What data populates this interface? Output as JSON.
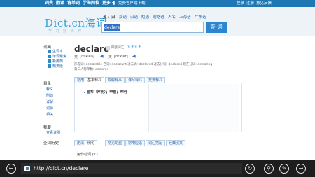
{
  "topnav": {
    "items": [
      "词典",
      "翻译",
      "背单词",
      "学海网校",
      "更多 ▾"
    ],
    "download": "免费客户端下载",
    "login": "登录",
    "register": "注册",
    "help": "意见反馈"
  },
  "header": {
    "logo": "Dict.cn海词",
    "logo_tagline": "学 习 好 伙 伴",
    "dict_tabs": [
      "英 ▸ 汉",
      "双语",
      "汉语",
      "短语",
      "缩略语",
      "人名",
      "上海话",
      "广东话"
    ],
    "search_value": "declare",
    "search_button": "查 词"
  },
  "sidebar": {
    "section1_title": "词典",
    "section1_items": [
      "生词本",
      "单词聚焦",
      "新奥典",
      "精英版"
    ],
    "section2_title": "目录",
    "section2_items": [
      "释义",
      "例句",
      "详解",
      "词源",
      "相关"
    ],
    "section3_title": "我要",
    "section3_items": [
      "查看说明"
    ],
    "section4_title": "查词历史"
  },
  "entry": {
    "word": "declare",
    "level_label": "四级词汇",
    "stars": "★★★★",
    "uk_label": "英",
    "uk_phonetic": "[dɪ'kleə]",
    "us_label": "美",
    "us_phonetic": "[dɪ'kler]",
    "forms": "形容词: declarable  名词: declarant  过去式: declared  过去分词: declared  现在分词: declaring",
    "forms2": "第三人称单数: declares",
    "tabs": [
      "常用",
      "基本释义",
      "双解释义",
      "详尽释义",
      "英英释义"
    ],
    "definition": "宣布（声明）；申报；声明",
    "example_tabs": [
      "用法",
      "例句",
      "常见句型",
      "常用短语",
      "词汇搭配",
      "经典引文"
    ],
    "section2_line": "用作动词 (v.)"
  },
  "browser": {
    "url": "http://dict.cn/declare"
  }
}
